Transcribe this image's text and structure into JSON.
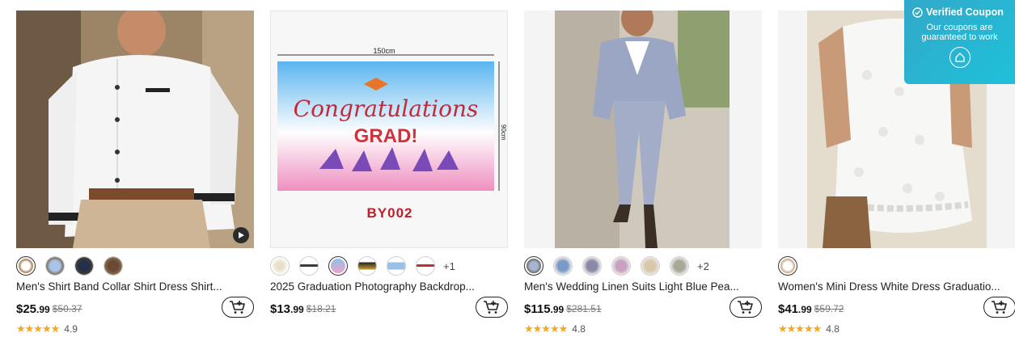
{
  "coupon": {
    "title": "Verified Coupon",
    "subtitle": "Our coupons are guaranteed to work"
  },
  "products": [
    {
      "title": "Men's Shirt Band Collar Shirt Dress Shirt...",
      "price_int": "$25",
      "price_dec": ".99",
      "old_price": "$50.37",
      "rating": "4.9",
      "stars": "★★★★★",
      "swatch_more": ""
    },
    {
      "title": "2025 Graduation Photography Backdrop...",
      "price_int": "$13",
      "price_dec": ".99",
      "old_price": "$18.21",
      "rating": "",
      "stars": "",
      "swatch_more": "+1",
      "image_text": {
        "width": "150cm",
        "height": "90cm",
        "line1": "Congratulations",
        "line2": "GRAD!",
        "code": "BY002"
      }
    },
    {
      "title": "Men's Wedding Linen Suits Light Blue Pea...",
      "price_int": "$115",
      "price_dec": ".99",
      "old_price": "$281.51",
      "rating": "4.8",
      "stars": "★★★★★",
      "swatch_more": "+2"
    },
    {
      "title": "Women's Mini Dress White Dress Graduatio...",
      "price_int": "$41",
      "price_dec": ".99",
      "old_price": "$59.72",
      "rating": "4.8",
      "stars": "★★★★★",
      "swatch_more": ""
    }
  ]
}
